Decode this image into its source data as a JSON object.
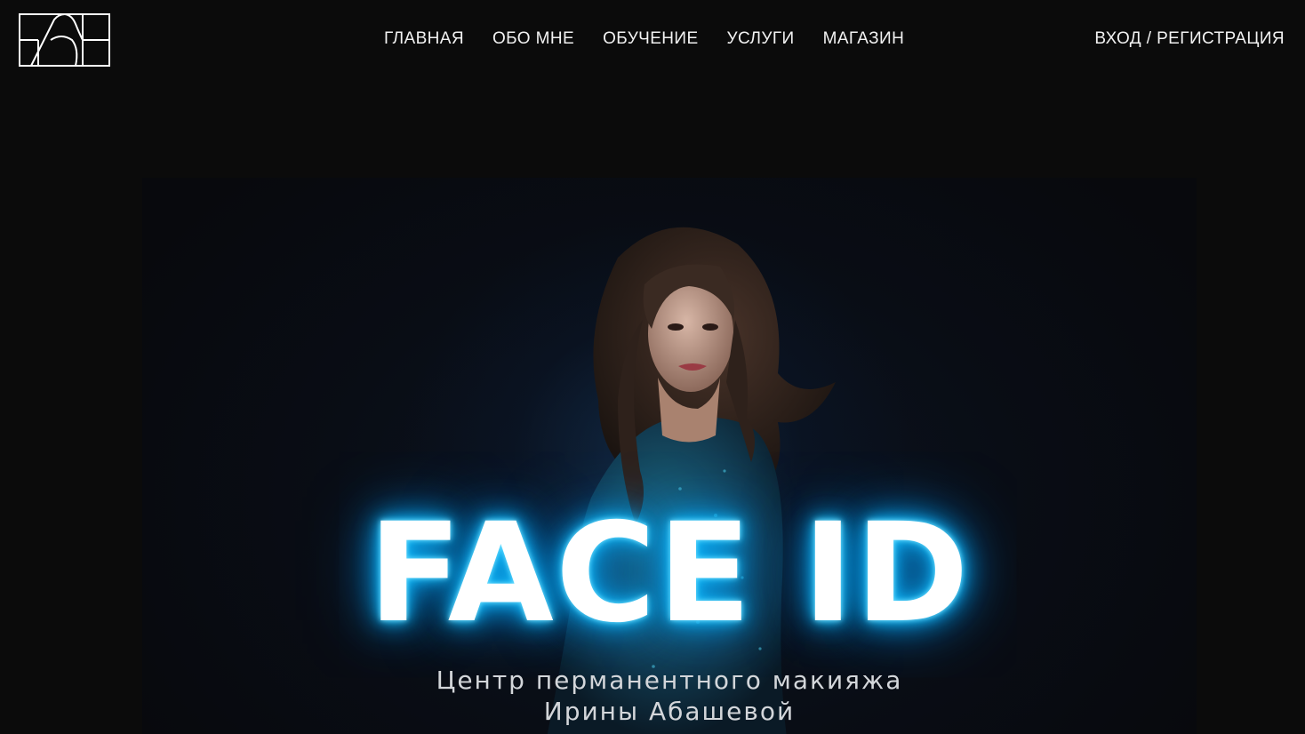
{
  "header": {
    "logo_icon": "monogram-logo-icon",
    "nav": [
      {
        "label": "ГЛАВНАЯ"
      },
      {
        "label": "ОБО МНЕ"
      },
      {
        "label": "ОБУЧЕНИЕ"
      },
      {
        "label": "УСЛУГИ"
      },
      {
        "label": "МАГАЗИН"
      }
    ],
    "auth_label": "ВХОД / РЕГИСТРАЦИЯ"
  },
  "hero": {
    "headline": "FACE ID",
    "subtitle_line1": "Центр перманентного макияжа",
    "subtitle_line2": "Ирины Абашевой",
    "photo": "woman-portrait-image",
    "glow_color": "#19c3ff",
    "background_color": "#0b0b0b"
  }
}
